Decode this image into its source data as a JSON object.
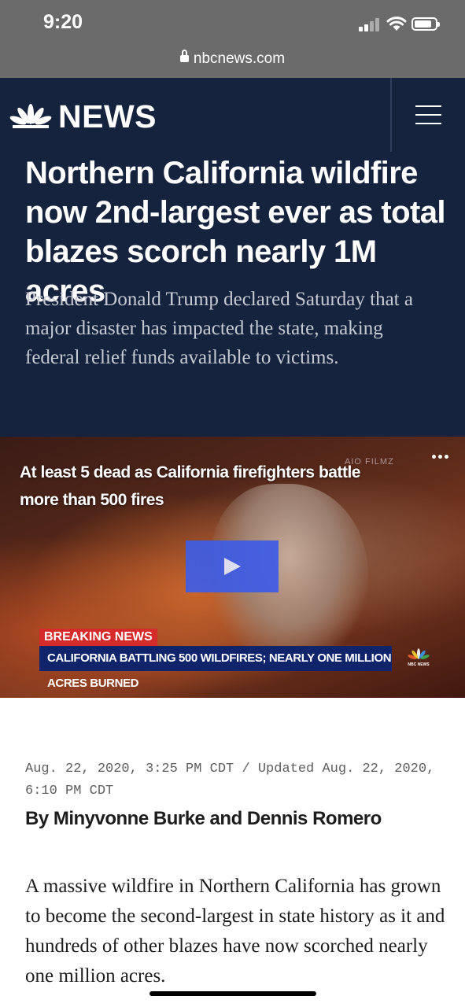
{
  "status_bar": {
    "time": "9:20",
    "battery_level": 0.85
  },
  "browser": {
    "url": "nbcnews.com"
  },
  "header": {
    "brand": "NEWS",
    "logo_icon": "nbc-peacock-icon",
    "menu_icon": "hamburger-menu-icon"
  },
  "article": {
    "headline": "Northern California wildfire now 2nd-largest ever as total blazes scorch nearly 1M acres",
    "dek": "President Donald Trump declared Saturday that a major disaster has impacted the state, making federal relief funds available to victims.",
    "dateline": "Aug. 22, 2020, 3:25 PM CDT / Updated Aug. 22, 2020, 6:10 PM CDT",
    "byline": "By Minyvonne Burke and Dennis Romero",
    "body": "A massive wildfire in Northern California has grown to become the second-largest in state history as it and hundreds of other blazes have now scorched nearly one million acres."
  },
  "video": {
    "title": "At least 5 dead as California firefighters battle more than 500 fires",
    "watermark": "AIO FILMZ",
    "breaking_label": "BREAKING NEWS",
    "ticker": "CALIFORNIA BATTLING 500 WILDFIRES; NEARLY ONE MILLION ACRES BURNED",
    "ticker_logo": "NBC NEWS",
    "play_icon": "play-icon",
    "more_icon": "more-options-icon"
  },
  "colors": {
    "hero_background": "#16233f",
    "status_bar": "#6b6b6b",
    "play_button": "#3e5de6",
    "breaking_red": "#d62b2b",
    "ticker_blue": "#10246b"
  }
}
